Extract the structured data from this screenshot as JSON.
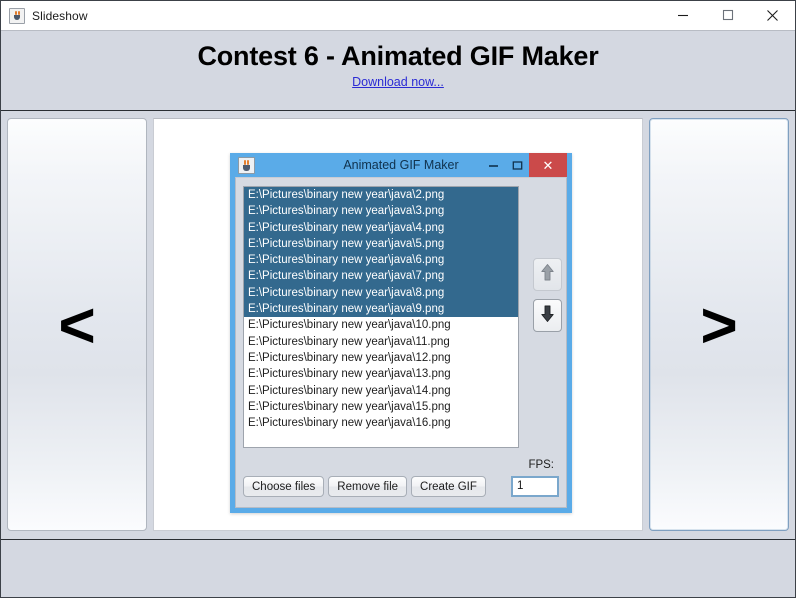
{
  "window": {
    "title": "Slideshow",
    "icon": "java-cup-icon",
    "controls": {
      "minimize": "minimize-icon",
      "maximize": "maximize-icon",
      "close": "close-icon"
    }
  },
  "header": {
    "title": "Contest 6 - Animated GIF Maker",
    "link_text": "Download now..."
  },
  "nav": {
    "prev_glyph": "<",
    "next_glyph": ">"
  },
  "inner_window": {
    "title": "Animated GIF Maker",
    "icon": "java-cup-icon",
    "controls": {
      "minimize": "minimize-icon",
      "maximize": "maximize-icon",
      "close": "close-icon",
      "close_glyph": "✕"
    },
    "file_list": [
      {
        "path": "E:\\Pictures\\binary new year\\java\\2.png",
        "selected": true
      },
      {
        "path": "E:\\Pictures\\binary new year\\java\\3.png",
        "selected": true
      },
      {
        "path": "E:\\Pictures\\binary new year\\java\\4.png",
        "selected": true
      },
      {
        "path": "E:\\Pictures\\binary new year\\java\\5.png",
        "selected": true
      },
      {
        "path": "E:\\Pictures\\binary new year\\java\\6.png",
        "selected": true
      },
      {
        "path": "E:\\Pictures\\binary new year\\java\\7.png",
        "selected": true
      },
      {
        "path": "E:\\Pictures\\binary new year\\java\\8.png",
        "selected": true
      },
      {
        "path": "E:\\Pictures\\binary new year\\java\\9.png",
        "selected": true
      },
      {
        "path": "E:\\Pictures\\binary new year\\java\\10.png",
        "selected": false
      },
      {
        "path": "E:\\Pictures\\binary new year\\java\\11.png",
        "selected": false
      },
      {
        "path": "E:\\Pictures\\binary new year\\java\\12.png",
        "selected": false
      },
      {
        "path": "E:\\Pictures\\binary new year\\java\\13.png",
        "selected": false
      },
      {
        "path": "E:\\Pictures\\binary new year\\java\\14.png",
        "selected": false
      },
      {
        "path": "E:\\Pictures\\binary new year\\java\\15.png",
        "selected": false
      },
      {
        "path": "E:\\Pictures\\binary new year\\java\\16.png",
        "selected": false
      }
    ],
    "reorder": {
      "up_icon": "arrow-up-icon",
      "down_icon": "arrow-down-icon"
    },
    "buttons": {
      "choose_files": "Choose files",
      "remove_file": "Remove file",
      "create_gif": "Create GIF"
    },
    "fps": {
      "label": "FPS:",
      "value": "1"
    }
  },
  "colors": {
    "window_chrome": "#d4d8e1",
    "inner_frame_blue": "#5aabe8",
    "list_selection": "#33698e",
    "close_red": "#cb4a4a",
    "link_blue": "#2b2bd4",
    "focus_border": "#7aa7cc"
  }
}
